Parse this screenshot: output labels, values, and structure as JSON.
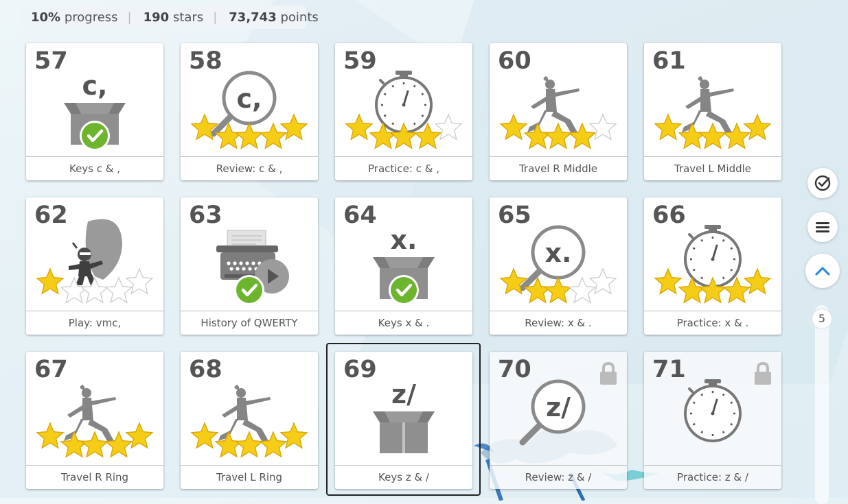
{
  "header": {
    "progress_value": "10%",
    "progress_label": "progress",
    "stars_value": "190",
    "stars_label": "stars",
    "points_value": "73,743",
    "points_label": "points"
  },
  "tiles": [
    {
      "number": "57",
      "title": "Keys c & ,",
      "glyph": "c,",
      "icon": "box-icon",
      "completed": true
    },
    {
      "number": "58",
      "title": "Review: c & ,",
      "glyph": "c,",
      "icon": "magnifier-icon",
      "stars": 5
    },
    {
      "number": "59",
      "title": "Practice: c & ,",
      "icon": "stopwatch-icon",
      "stars": 4
    },
    {
      "number": "60",
      "title": "Travel R Middle",
      "icon": "yoga-figure-icon",
      "stars": 4
    },
    {
      "number": "61",
      "title": "Travel L Middle",
      "icon": "yoga-figure-icon",
      "stars": 5
    },
    {
      "number": "62",
      "title": "Play: vmc,",
      "icon": "ninja-balloon-icon",
      "stars": 1
    },
    {
      "number": "63",
      "title": "History of QWERTY",
      "icon": "typewriter-icon",
      "completed": true
    },
    {
      "number": "64",
      "title": "Keys x & .",
      "glyph": "x.",
      "icon": "box-icon",
      "completed": true
    },
    {
      "number": "65",
      "title": "Review: x & .",
      "glyph": "x.",
      "icon": "magnifier-icon",
      "stars": 3
    },
    {
      "number": "66",
      "title": "Practice: x & .",
      "icon": "stopwatch-icon",
      "stars": 5
    },
    {
      "number": "67",
      "title": "Travel R Ring",
      "icon": "yoga-figure-icon",
      "stars": 5
    },
    {
      "number": "68",
      "title": "Travel L Ring",
      "icon": "yoga-figure-icon",
      "stars": 5
    },
    {
      "number": "69",
      "title": "Keys z & /",
      "glyph": "z/",
      "icon": "box-icon",
      "selected": true
    },
    {
      "number": "70",
      "title": "Review: z & /",
      "glyph": "z/",
      "icon": "magnifier-icon",
      "locked": true
    },
    {
      "number": "71",
      "title": "Practice: z & /",
      "icon": "stopwatch-icon",
      "locked": true
    }
  ],
  "sidebar": {
    "check_icon": "check-circle-icon",
    "menu_icon": "menu-icon",
    "up_icon": "chevron-up-icon",
    "scroll_position_label": "5"
  },
  "colors": {
    "star": "#f5cc16",
    "check": "#6cb52d",
    "accent": "#2b8fd6",
    "icon_grey": "#8a8a8a"
  }
}
